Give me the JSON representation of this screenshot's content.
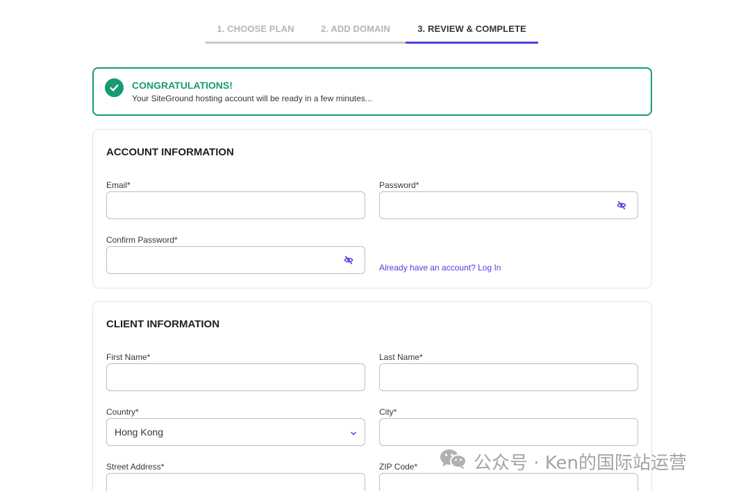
{
  "steps": [
    {
      "label": "1. CHOOSE PLAN"
    },
    {
      "label": "2. ADD DOMAIN"
    },
    {
      "label": "3. REVIEW & COMPLETE"
    }
  ],
  "banner": {
    "title": "CONGRATULATIONS!",
    "message": "Your SiteGround hosting account will be ready in a few minutes..."
  },
  "account": {
    "title": "ACCOUNT INFORMATION",
    "email_label": "Email*",
    "password_label": "Password*",
    "confirm_label": "Confirm Password*",
    "login_link": "Already have an account? Log In"
  },
  "client": {
    "title": "CLIENT INFORMATION",
    "first_name_label": "First Name*",
    "last_name_label": "Last Name*",
    "country_label": "Country*",
    "country_value": "Hong Kong",
    "city_label": "City*",
    "street_label": "Street Address*",
    "zip_label": "ZIP Code*"
  },
  "watermark": {
    "text": "公众号 · Ken的国际站运营"
  },
  "colors": {
    "accent": "#4a40e0",
    "success": "#169b74"
  }
}
